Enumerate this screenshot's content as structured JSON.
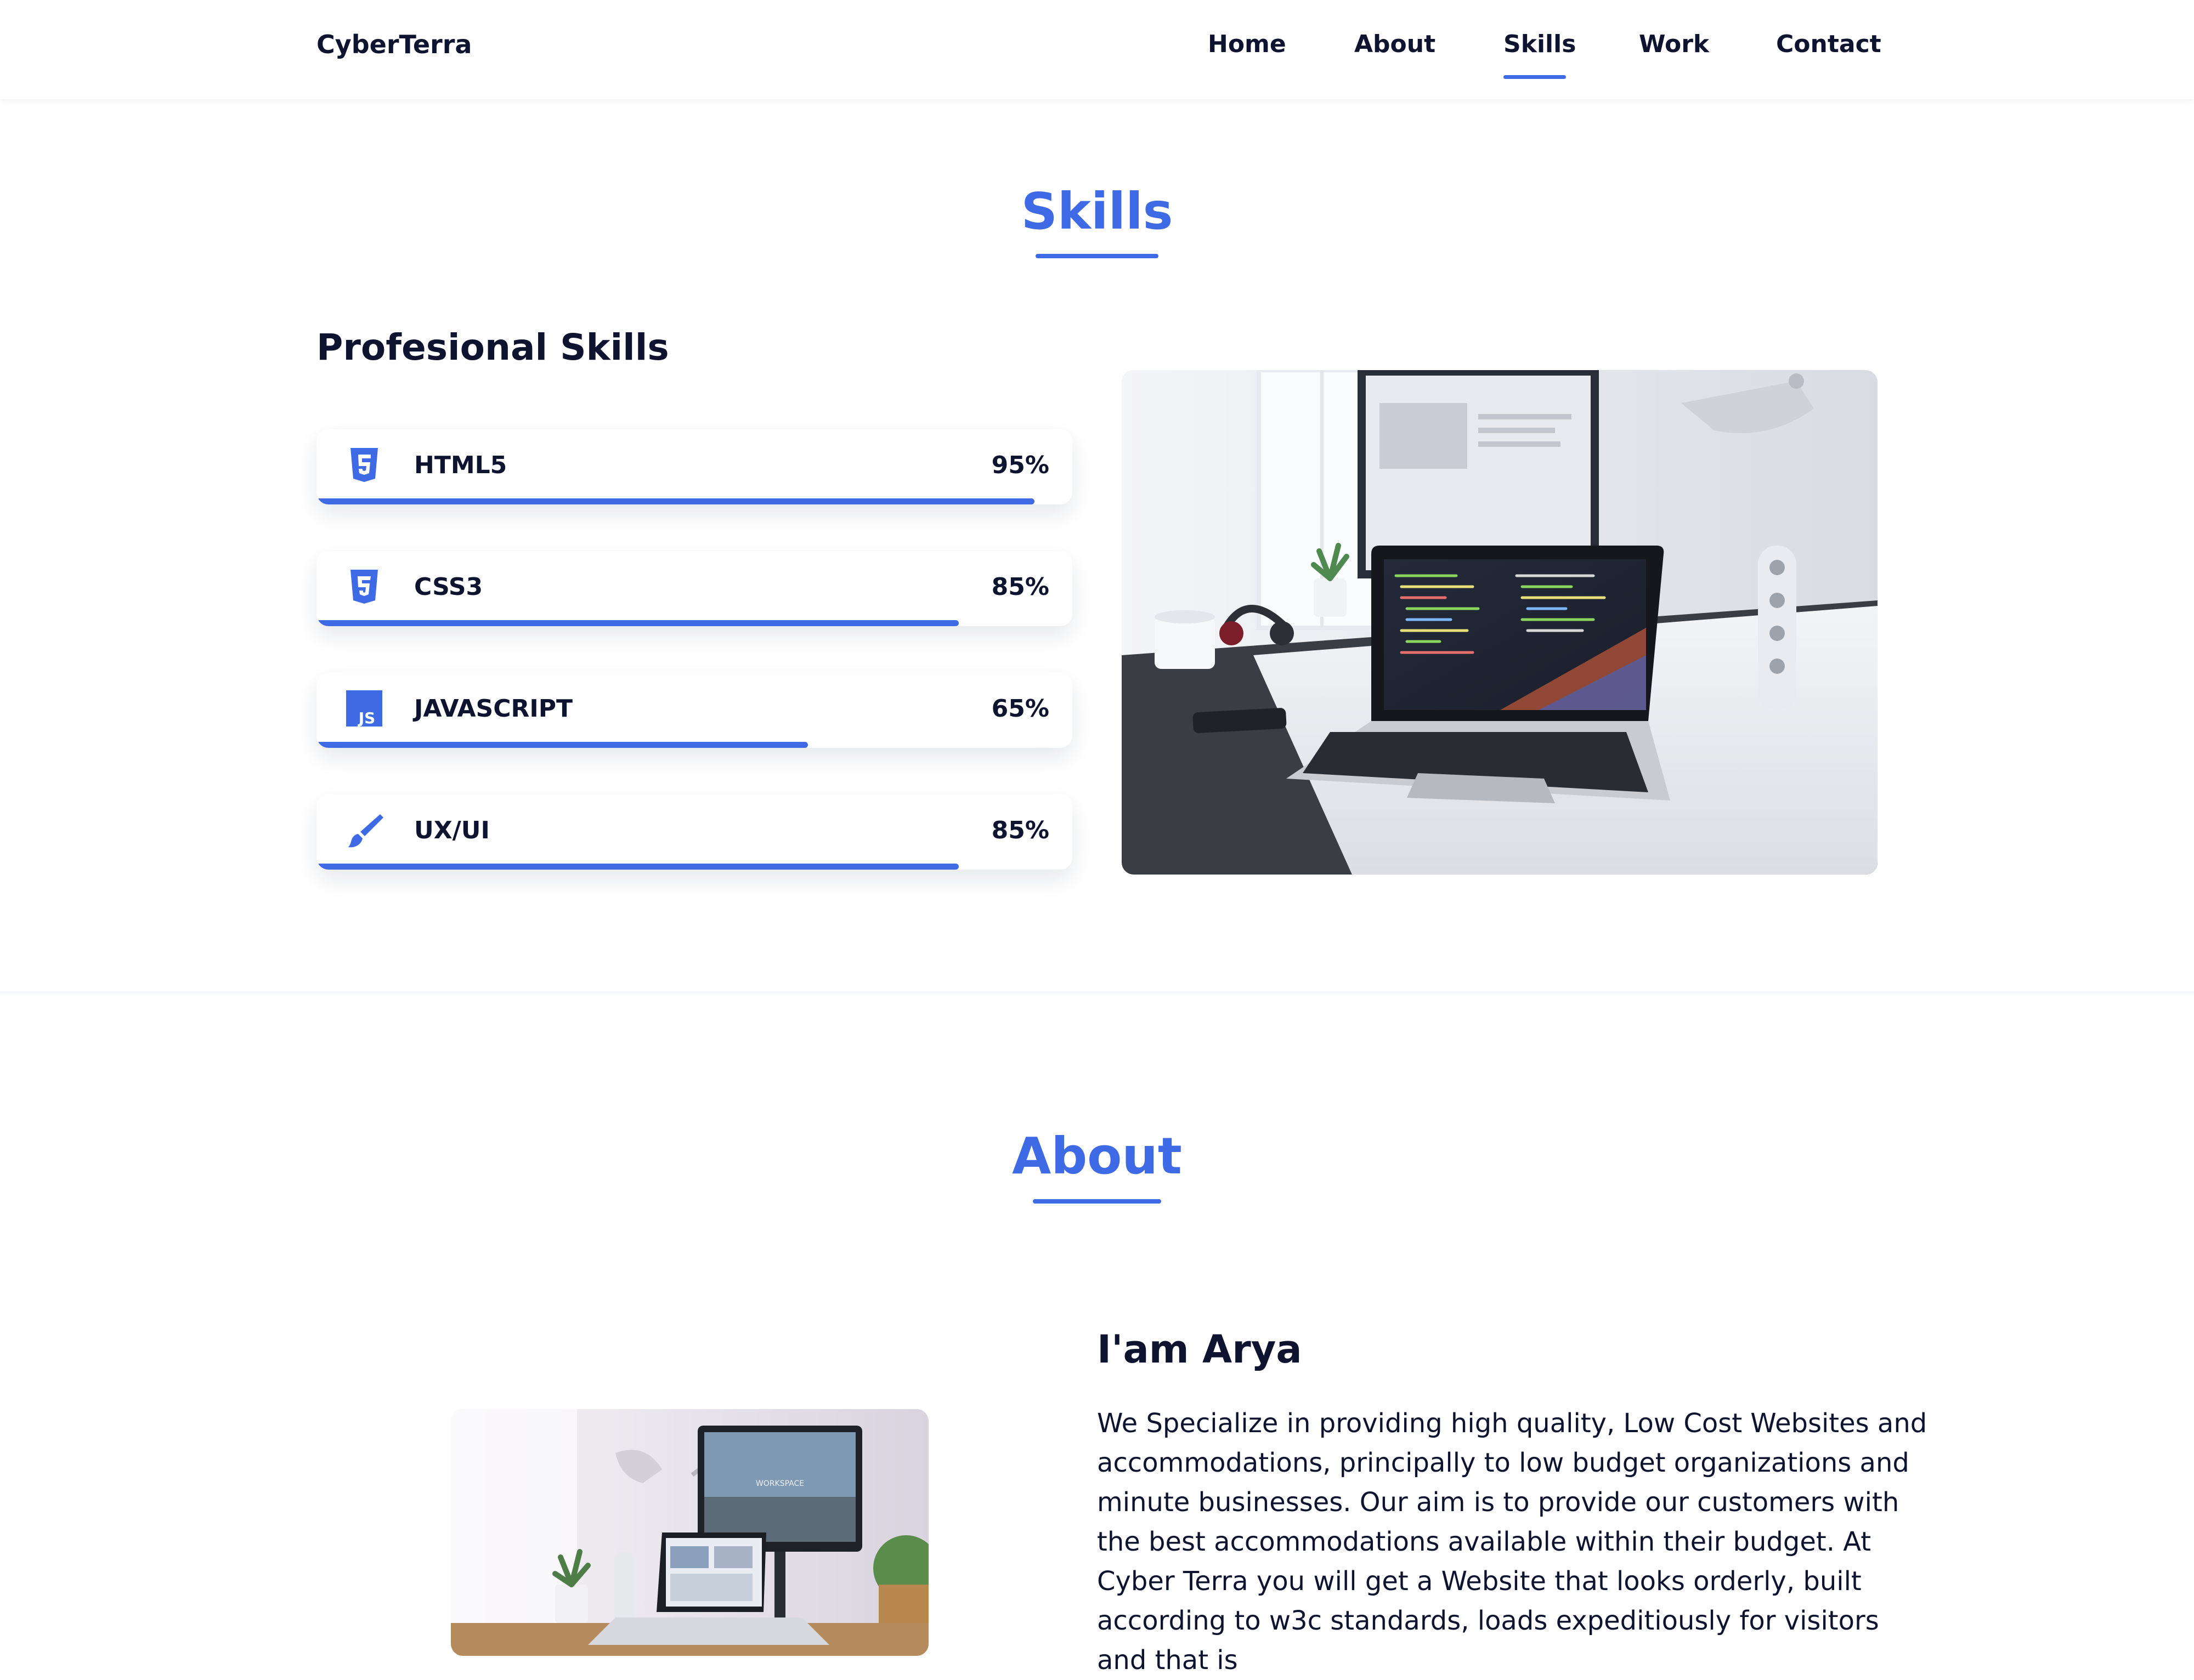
{
  "header": {
    "logo": "CyberTerra",
    "nav": [
      "Home",
      "About",
      "Skills",
      "Work",
      "Contact"
    ],
    "active_nav": "Skills"
  },
  "skills_section": {
    "title": "Skills",
    "subheading": "Profesional Skills",
    "items": [
      {
        "name": "HTML5",
        "percent_label": "95%",
        "percent": 95,
        "icon": "html5-icon"
      },
      {
        "name": "CSS3",
        "percent_label": "85%",
        "percent": 85,
        "icon": "css3-icon"
      },
      {
        "name": "JAVASCRIPT",
        "percent_label": "65%",
        "percent": 65,
        "icon": "javascript-icon"
      },
      {
        "name": "UX/UI",
        "percent_label": "85%",
        "percent": 85,
        "icon": "brush-icon"
      }
    ],
    "image": "laptop-desk-photo"
  },
  "about_section": {
    "title": "About",
    "name_heading": "I'am Arya",
    "paragraph": "We Specialize in providing high quality, Low Cost Websites and accommodations, principally to low budget organizations and minute businesses. Our aim is to provide our customers with the best accommodations available within their budget. At Cyber Terra you will get a Website that looks orderly, built according to w3c standards, loads expeditiously for visitors and that is",
    "image": "workspace-photo"
  },
  "colors": {
    "accent": "#3f6ae6",
    "text": "#0e1330",
    "background": "#ffffff"
  }
}
